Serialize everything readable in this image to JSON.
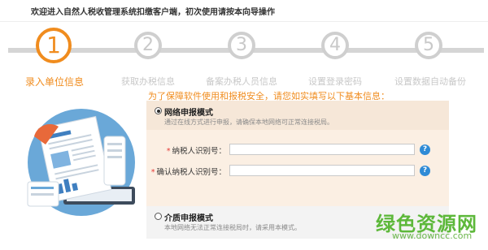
{
  "header": {
    "title": "欢迎进入自然人税收管理系统扣缴客户端，初次使用请按本向导操作"
  },
  "steps": [
    {
      "number": "1",
      "label": "录入单位信息",
      "active": true
    },
    {
      "number": "2",
      "label": "获取办税信息",
      "active": false
    },
    {
      "number": "3",
      "label": "备案办税人员信息",
      "active": false
    },
    {
      "number": "4",
      "label": "设置登录密码",
      "active": false
    },
    {
      "number": "5",
      "label": "设置数据自动备份",
      "active": false
    }
  ],
  "hint": "为了保障软件使用和报税安全，请您如实填写以下基本信息：",
  "network_mode": {
    "title": "网络申报模式",
    "desc": "通过在线方式进行申报，请确保本地网络可正常连接税局。",
    "selected": true
  },
  "fields": [
    {
      "required": "*",
      "label": "纳税人识别号：",
      "value": ""
    },
    {
      "required": "*",
      "label": "确认纳税人识别号：",
      "value": ""
    }
  ],
  "help_glyph": "?",
  "paper_mode": {
    "title": "介质申报模式",
    "desc": "本地网络无法正常连接税局时，请采用本模式。",
    "selected": false
  },
  "watermark": {
    "brand": "绿色资源网",
    "url": "www.downcc.com"
  },
  "colors": {
    "accent": "#f08c1e",
    "inactive": "#cfcfcf",
    "help": "#2f8bd6",
    "panel": "#fbefe3"
  }
}
